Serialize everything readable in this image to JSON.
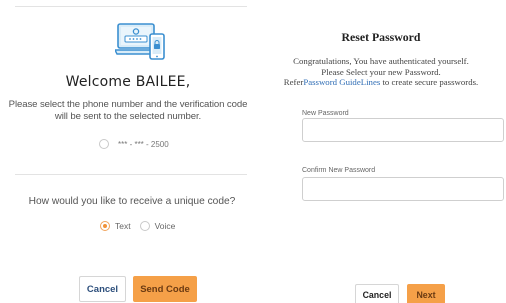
{
  "left": {
    "welcome": "Welcome  BAILEE,",
    "instructions_line1": "Please select the phone number and the verification code",
    "instructions_line2": "will be sent to the selected number.",
    "phone_option": "*** - *** - 2500",
    "question": "How would you like to receive a unique code?",
    "methods": [
      {
        "label": "Text",
        "selected": true
      },
      {
        "label": "Voice",
        "selected": false
      }
    ],
    "cancel_label": "Cancel",
    "send_label": "Send Code"
  },
  "right": {
    "title": "Reset Password",
    "line1": "Congratulations, You have authenticated yourself.",
    "line2": "Please Select your new Password.",
    "line3_prefix": "Refer",
    "line3_link": "Password GuideLines",
    "line3_suffix": " to create secure passwords.",
    "new_password_label": "New Password",
    "confirm_password_label": "Confirm New Password",
    "cancel_label": "Cancel",
    "next_label": "Next"
  },
  "colors": {
    "accent": "#f5a048",
    "link": "#2f6db5",
    "icon_blue": "#3b8fd0"
  },
  "icons": [
    "laptop-phone-lock-icon"
  ]
}
